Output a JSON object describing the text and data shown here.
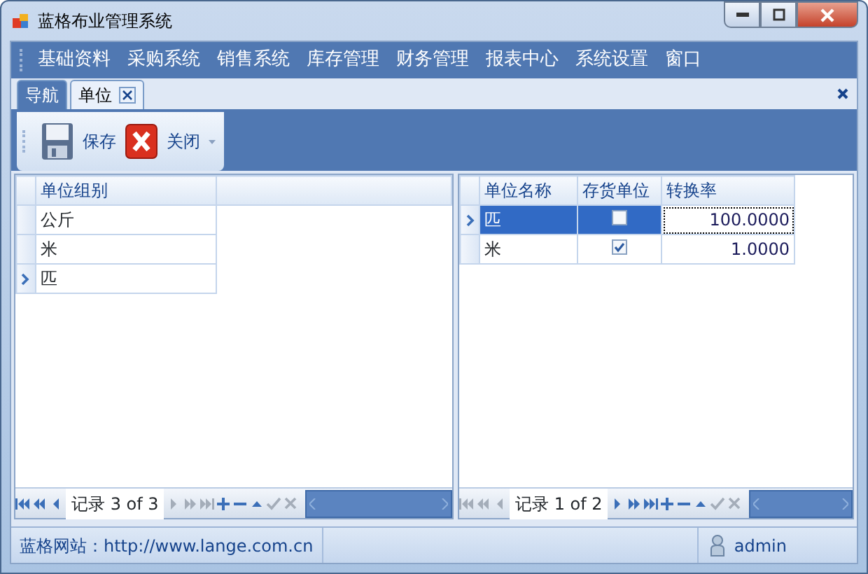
{
  "window": {
    "title": "蓝格布业管理系统"
  },
  "menu": [
    "基础资料",
    "采购系统",
    "销售系统",
    "库存管理",
    "财务管理",
    "报表中心",
    "系统设置",
    "窗口"
  ],
  "tabs": [
    {
      "label": "导航",
      "selected": false,
      "closable": false
    },
    {
      "label": "单位",
      "selected": true,
      "closable": true
    }
  ],
  "toolbar": [
    {
      "kind": "save",
      "label": "保存"
    },
    {
      "kind": "close",
      "label": "关闭"
    }
  ],
  "left_grid": {
    "columns": [
      "单位组别"
    ],
    "rows": [
      {
        "cells": [
          "公斤"
        ],
        "selected": false
      },
      {
        "cells": [
          "米"
        ],
        "selected": false
      },
      {
        "cells": [
          "匹"
        ],
        "selected": true
      }
    ],
    "navigator": {
      "record": "记录 3 of 3",
      "buttons": [
        {
          "kind": "first",
          "disabled": false
        },
        {
          "kind": "prev-page",
          "disabled": false
        },
        {
          "kind": "prev",
          "disabled": false
        },
        {
          "kind": "next",
          "disabled": true
        },
        {
          "kind": "next-page",
          "disabled": true
        },
        {
          "kind": "last",
          "disabled": true
        },
        {
          "kind": "append",
          "disabled": false
        },
        {
          "kind": "remove",
          "disabled": false
        },
        {
          "kind": "edit",
          "disabled": false
        },
        {
          "kind": "post",
          "disabled": true
        },
        {
          "kind": "cancel",
          "disabled": true
        }
      ]
    }
  },
  "right_grid": {
    "columns": [
      "单位名称",
      "存货单位",
      "转换率"
    ],
    "rows": [
      {
        "name": "匹",
        "stock_unit": false,
        "rate": "100.0000",
        "selected": true
      },
      {
        "name": "米",
        "stock_unit": true,
        "rate": "1.0000",
        "selected": false
      }
    ],
    "navigator": {
      "record": "记录 1 of 2",
      "buttons": [
        {
          "kind": "first",
          "disabled": true
        },
        {
          "kind": "prev-page",
          "disabled": true
        },
        {
          "kind": "prev",
          "disabled": true
        },
        {
          "kind": "next",
          "disabled": false
        },
        {
          "kind": "next-page",
          "disabled": false
        },
        {
          "kind": "last",
          "disabled": false
        },
        {
          "kind": "append",
          "disabled": false
        },
        {
          "kind": "remove",
          "disabled": false
        },
        {
          "kind": "edit",
          "disabled": false
        },
        {
          "kind": "post",
          "disabled": true
        },
        {
          "kind": "cancel",
          "disabled": true
        }
      ]
    }
  },
  "status_bar": {
    "website": "蓝格网站：http://www.lange.com.cn",
    "user": "admin"
  }
}
